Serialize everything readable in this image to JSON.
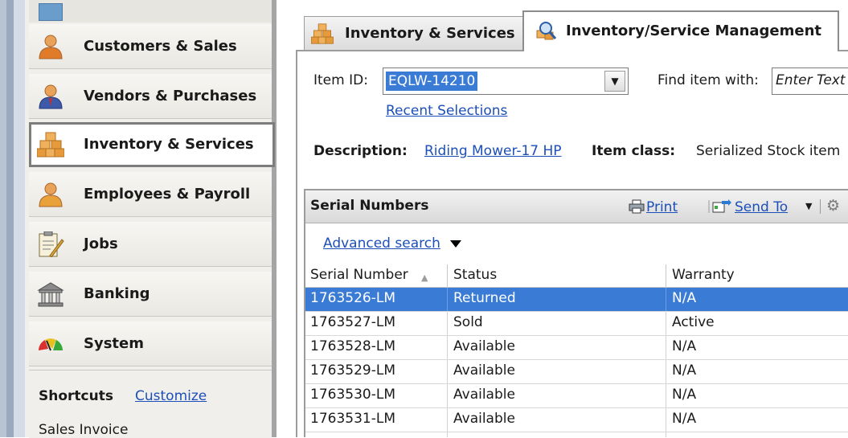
{
  "nav": {
    "items": [
      {
        "label": "Customers & Sales",
        "icon": "person-icon"
      },
      {
        "label": "Vendors & Purchases",
        "icon": "person-suit-icon"
      },
      {
        "label": "Inventory & Services",
        "icon": "boxes-icon"
      },
      {
        "label": "Employees & Payroll",
        "icon": "person-icon"
      },
      {
        "label": "Jobs",
        "icon": "clipboard-icon"
      },
      {
        "label": "Banking",
        "icon": "bank-icon"
      },
      {
        "label": "System",
        "icon": "gauge-icon"
      }
    ],
    "active_index": 2
  },
  "shortcuts": {
    "title": "Shortcuts",
    "customize": "Customize",
    "first_item": "Sales Invoice"
  },
  "tabs": [
    {
      "label": "Inventory & Services"
    },
    {
      "label": "Inventory/Service Management"
    }
  ],
  "item": {
    "id_label": "Item ID:",
    "id_value": "EQLW-14210",
    "recent": "Recent Selections",
    "find_label": "Find item with:",
    "find_placeholder": "Enter Text",
    "desc_label": "Description:",
    "desc_value": "Riding Mower-17 HP",
    "class_label": "Item class:",
    "class_value": "Serialized Stock item"
  },
  "serials": {
    "title": "Serial Numbers",
    "print": "Print",
    "send_to": "Send To",
    "advanced": "Advanced search",
    "columns": [
      "Serial Number",
      "Status",
      "Warranty"
    ],
    "rows": [
      [
        "1763526-LM",
        "Returned",
        "N/A"
      ],
      [
        "1763527-LM",
        "Sold",
        "Active"
      ],
      [
        "1763528-LM",
        "Available",
        "N/A"
      ],
      [
        "1763529-LM",
        "Available",
        "N/A"
      ],
      [
        "1763530-LM",
        "Available",
        "N/A"
      ],
      [
        "1763531-LM",
        "Available",
        "N/A"
      ]
    ],
    "selected_row": 0
  },
  "colors": {
    "selection": "#3a7bd5",
    "link": "#1c4fb8"
  }
}
